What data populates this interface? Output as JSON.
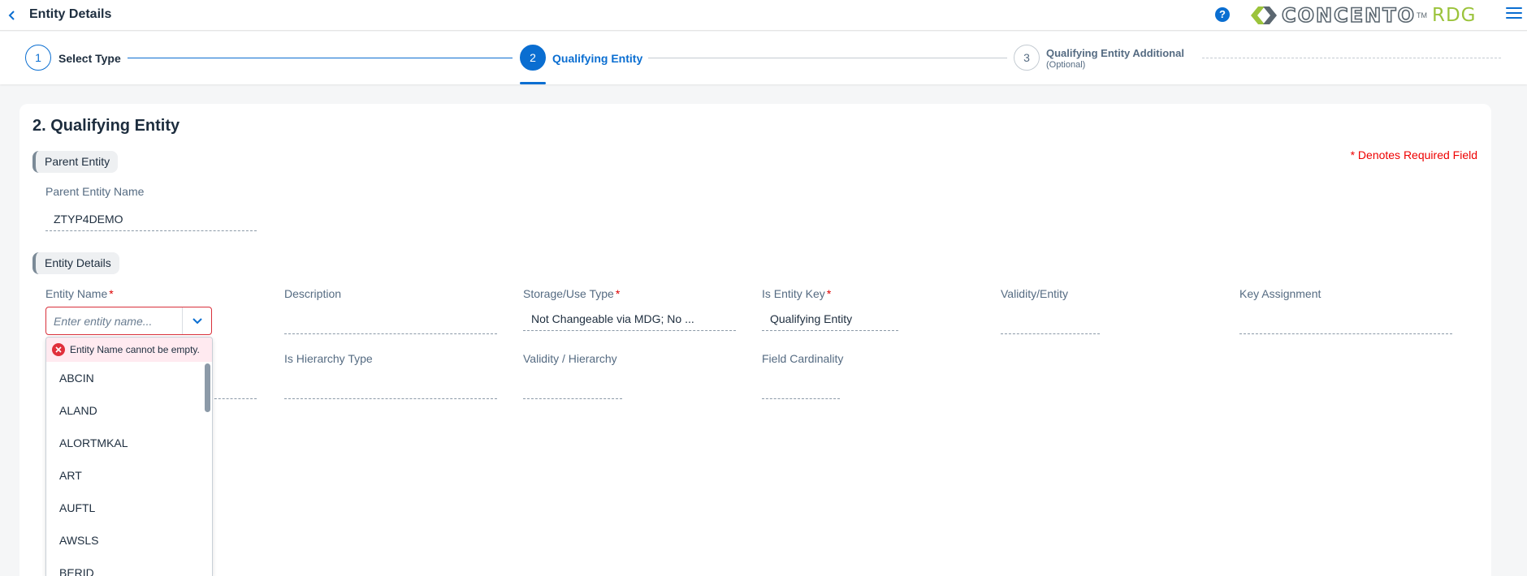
{
  "header": {
    "title": "Entity Details",
    "help_glyph": "?",
    "logo_text": "CONCENTO",
    "logo_tm": "TM",
    "logo_suffix": "RDG"
  },
  "wizard": {
    "steps": [
      {
        "number": "1",
        "label": "Select Type",
        "state": "completed"
      },
      {
        "number": "2",
        "label": "Qualifying Entity",
        "state": "active"
      },
      {
        "number": "3",
        "label": "Qualifying Entity Additional",
        "sublabel": "(Optional)",
        "state": "pending"
      }
    ]
  },
  "section": {
    "title": "2. Qualifying Entity",
    "required_note": "* Denotes Required Field"
  },
  "parent_group": {
    "label": "Parent Entity",
    "parent_name_label": "Parent Entity Name",
    "parent_name_value": "ZTYP4DEMO"
  },
  "entity_group": {
    "label": "Entity Details",
    "fields": {
      "entity_name": {
        "label": "Entity Name",
        "required": "*",
        "placeholder": "Enter entity name...",
        "value": ""
      },
      "description": {
        "label": "Description",
        "value": ""
      },
      "storage_use_type": {
        "label": "Storage/Use Type",
        "required": "*",
        "value": "Not Changeable via MDG; No ..."
      },
      "is_entity_key": {
        "label": "Is Entity Key",
        "required": "*",
        "value": "Qualifying Entity"
      },
      "validity_entity": {
        "label": "Validity/Entity",
        "value": ""
      },
      "key_assignment": {
        "label": "Key Assignment",
        "value": ""
      },
      "is_hierarchy_type": {
        "label": "Is Hierarchy Type",
        "value": ""
      },
      "validity_hierarchy": {
        "label": "Validity / Hierarchy",
        "value": ""
      },
      "field_cardinality": {
        "label": "Field Cardinality",
        "value": ""
      }
    }
  },
  "dropdown": {
    "error": "Entity Name cannot be empty.",
    "items": [
      "ABCIN",
      "ALAND",
      "ALORTMKAL",
      "ART",
      "AUFTL",
      "AWSLS",
      "BERID"
    ]
  },
  "colors": {
    "accent": "#0a6ed1",
    "error": "#d9303b",
    "logo_gray": "#5b6770",
    "logo_green": "#9bc33b"
  }
}
